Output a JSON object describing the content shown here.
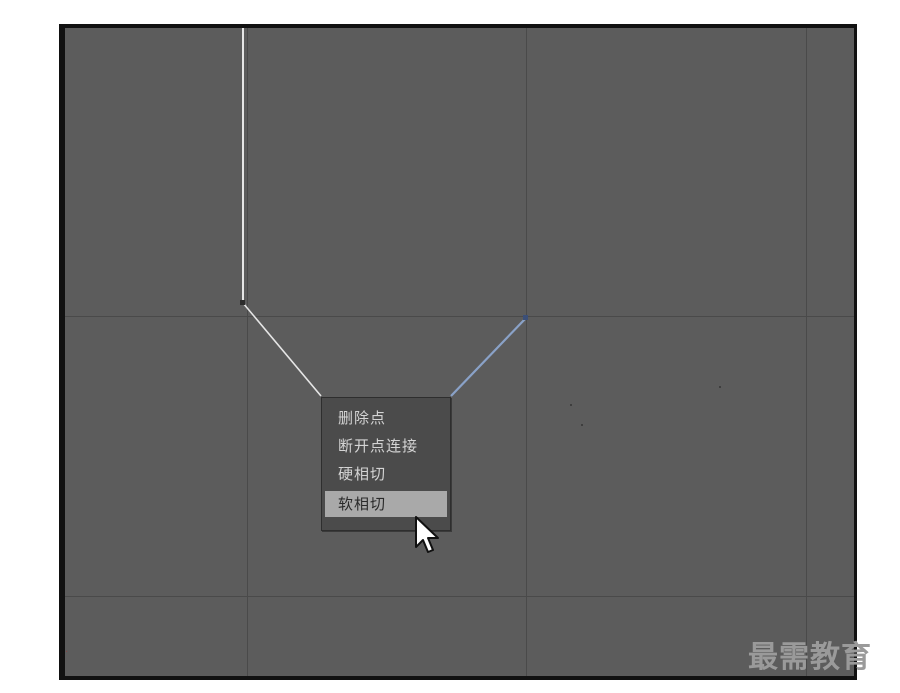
{
  "context_menu": {
    "items": [
      {
        "label": "删除点"
      },
      {
        "label": "断开点连接"
      },
      {
        "label": "硬相切"
      },
      {
        "label": "软相切"
      }
    ],
    "highlighted_index": 3
  },
  "viewport": {
    "background_color": "#5c5c5c",
    "grid_color": "#4a4a4a",
    "spline_color": "#e6e6e6",
    "selected_segment_color": "#8aa2c8"
  },
  "watermark": {
    "text": "最需教育"
  },
  "icons": {
    "cursor": "arrow-cursor-icon"
  }
}
